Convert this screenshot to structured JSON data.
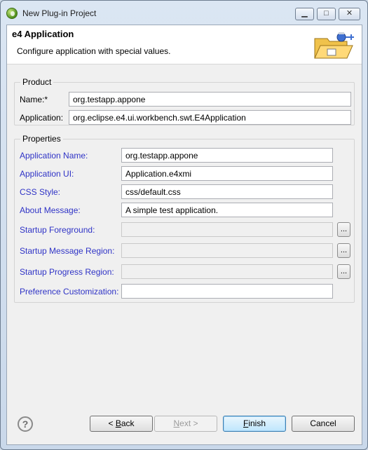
{
  "window": {
    "title": "New Plug-in Project",
    "minimize_glyph": "▁",
    "maximize_glyph": "□",
    "close_glyph": "✕"
  },
  "header": {
    "title": "e4 Application",
    "description": "Configure application with special values."
  },
  "product": {
    "group_title": "Product",
    "name_label": "Name:*",
    "name_value": "org.testapp.appone",
    "application_label": "Application:",
    "application_value": "org.eclipse.e4.ui.workbench.swt.E4Application"
  },
  "properties": {
    "group_title": "Properties",
    "rows": [
      {
        "label": "Application Name:",
        "value": ""
      },
      {
        "label": "Application UI:",
        "value": ""
      },
      {
        "label": "CSS Style:",
        "value": ""
      },
      {
        "label": "About Message:",
        "value": ""
      },
      {
        "label": "Startup Foreground:",
        "value": ""
      },
      {
        "label": "Startup Message Region:",
        "value": ""
      },
      {
        "label": "Startup Progress Region:",
        "value": ""
      },
      {
        "label": "Preference Customization:",
        "value": ""
      }
    ],
    "application_name": "org.testapp.appone",
    "application_ui": "Application.e4xmi",
    "css_style": "css/default.css",
    "about_message": "A simple test application.",
    "browse_label": "..."
  },
  "footer": {
    "help_glyph": "?",
    "back_prefix": "< ",
    "back_mnemonic": "B",
    "back_rest": "ack",
    "next_mnemonic": "N",
    "next_rest": "ext >",
    "finish_mnemonic": "F",
    "finish_rest": "inish",
    "cancel_label": "Cancel"
  },
  "colors": {
    "link_label": "#2f33c6",
    "default_button_border": "#3c7fb1"
  }
}
